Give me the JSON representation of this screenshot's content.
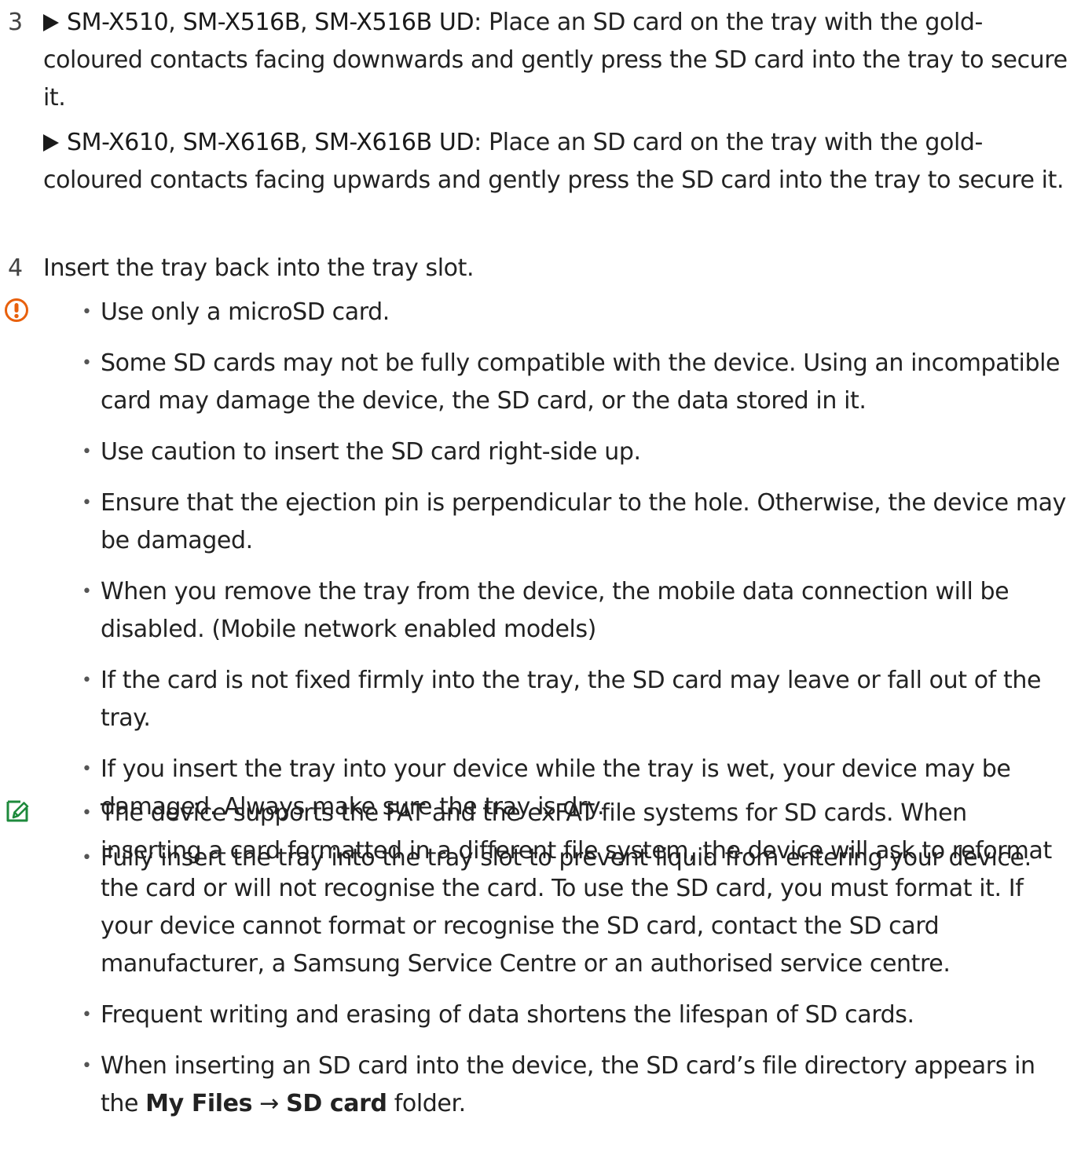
{
  "step3": {
    "number": "3",
    "para1": {
      "models": [
        "SM-X510",
        "SM-X516B",
        "SM-X516B UD"
      ],
      "sep": ", ",
      "text": ": Place an SD card on the tray with the gold-coloured contacts facing downwards and gently press the SD card into the tray to secure it."
    },
    "para2": {
      "models": [
        "SM-X610",
        "SM-X616B",
        "SM-X616B UD"
      ],
      "sep": ", ",
      "text": ": Place an SD card on the tray with the gold-coloured contacts facing upwards and gently press the SD card into the tray to secure it."
    }
  },
  "step4": {
    "number": "4",
    "text": "Insert the tray back into the tray slot."
  },
  "caution": {
    "icon": "caution-icon",
    "color": "#e8600c",
    "items": [
      "Use only a microSD card.",
      "Some SD cards may not be fully compatible with the device. Using an incompatible card may damage the device, the SD card, or the data stored in it.",
      "Use caution to insert the SD card right-side up.",
      "Ensure that the ejection pin is perpendicular to the hole. Otherwise, the device may be damaged.",
      "When you remove the tray from the device, the mobile data connection will be disabled. (Mobile network enabled models)",
      "If the card is not fixed firmly into the tray, the SD card may leave or fall out of the tray.",
      "If you insert the tray into your device while the tray is wet, your device may be damaged. Always make sure the tray is dry.",
      "Fully insert the tray into the tray slot to prevent liquid from entering your device."
    ]
  },
  "note": {
    "icon": "note-pen-icon",
    "color": "#1e8a3c",
    "items": [
      "The device supports the FAT and the exFAT file systems for SD cards. When inserting a card formatted in a different file system, the device will ask to reformat the card or will not recognise the card. To use the SD card, you must format it. If your device cannot format or recognise the SD card, contact the SD card manufacturer, a Samsung Service Centre or an authorised service centre.",
      "Frequent writing and erasing of data shortens the lifespan of SD cards."
    ],
    "last_item": {
      "pre": "When inserting an SD card into the device, the SD card’s file directory appears in the ",
      "bold1": "My Files",
      "arrow": " → ",
      "bold2": "SD card",
      "post": " folder."
    }
  }
}
